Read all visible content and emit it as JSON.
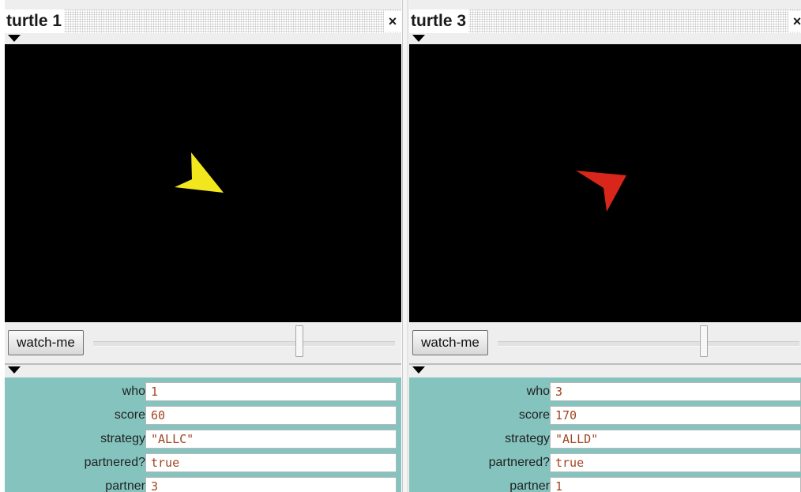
{
  "inspectors": [
    {
      "title": "turtle 1",
      "close_glyph": "×",
      "turtle_color": "#f2e61d",
      "watch_label": "watch-me",
      "vars": [
        {
          "label": "who",
          "value": "1"
        },
        {
          "label": "score",
          "value": "60"
        },
        {
          "label": "strategy",
          "value": "\"ALLC\""
        },
        {
          "label": "partnered?",
          "value": "true"
        },
        {
          "label": "partner",
          "value": "3"
        }
      ]
    },
    {
      "title": "turtle 3",
      "close_glyph": "×",
      "turtle_color": "#d8261a",
      "watch_label": "watch-me",
      "vars": [
        {
          "label": "who",
          "value": "3"
        },
        {
          "label": "score",
          "value": "170"
        },
        {
          "label": "strategy",
          "value": "\"ALLD\""
        },
        {
          "label": "partnered?",
          "value": "true"
        },
        {
          "label": "partner",
          "value": "1"
        }
      ]
    }
  ],
  "icons": {
    "close": "close-icon",
    "collapse": "collapse-triangle-icon"
  },
  "colors": {
    "var_panel_bg": "#84c3be",
    "value_text": "#a0451f",
    "view_bg": "#000000"
  }
}
